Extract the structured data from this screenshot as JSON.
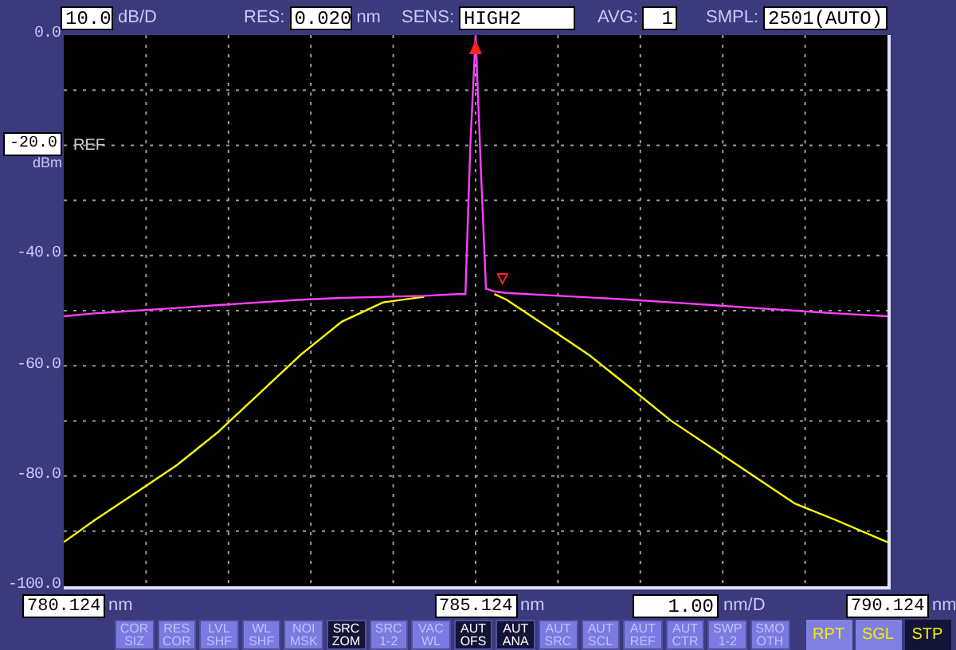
{
  "settings": [
    {
      "value": "10.0",
      "unit": "dB/D"
    },
    {
      "label": "RES:",
      "value": "0.020",
      "unit": "nm"
    },
    {
      "label": "SENS:",
      "value": "HIGH2"
    },
    {
      "label": "AVG:",
      "value": "1"
    },
    {
      "label": "SMPL:",
      "value": "2501(AUTO)"
    }
  ],
  "ref": {
    "value": "-20.0",
    "label": "REF",
    "unit": "dBm"
  },
  "chart_data": {
    "type": "line",
    "xlim": [
      780.124,
      790.124
    ],
    "ylim": [
      -100,
      0
    ],
    "grid": true,
    "xticks": [
      {
        "value": 780.124,
        "label": "780.124"
      },
      {
        "value": 785.124,
        "label": "785.124"
      },
      {
        "value": 790.124,
        "label": "790.124"
      }
    ],
    "yticks": [
      {
        "value": 0,
        "label": "0.0"
      },
      {
        "value": -40,
        "label": "-40.0"
      },
      {
        "value": -60,
        "label": "-60.0"
      },
      {
        "value": -80,
        "label": "-80.0"
      },
      {
        "value": -100,
        "label": "-100.0"
      }
    ],
    "x": [
      780.124,
      780.5,
      781,
      781.5,
      782,
      782.5,
      783,
      783.5,
      784,
      784.5,
      784.9,
      785.0,
      785.06,
      785.124,
      785.19,
      785.25,
      785.35,
      785.5,
      786,
      786.5,
      787,
      787.5,
      788,
      788.5,
      789,
      789.5,
      790.124
    ],
    "series": [
      {
        "color": "#ffff00",
        "values": [
          -92,
          -88,
          -83,
          -78,
          -72,
          -65,
          -58,
          -52,
          -48.5,
          -47.5,
          null,
          null,
          null,
          null,
          null,
          null,
          -47,
          -48,
          -53,
          -58,
          -64,
          -70,
          -75,
          -80,
          -85,
          -88,
          -92
        ]
      },
      {
        "color": "#ff40ff",
        "values": [
          -51,
          -50.5,
          -50,
          -49.5,
          -49,
          -48.5,
          -48,
          -47.7,
          -47.5,
          -47.3,
          -47,
          -47,
          -20,
          0,
          -25,
          -46,
          -46.5,
          -46.8,
          -47.2,
          -47.6,
          -48,
          -48.5,
          -49,
          -49.5,
          -50,
          -50.5,
          -51
        ]
      }
    ]
  },
  "x_units": [
    "nm",
    "nm",
    "nm"
  ],
  "span": {
    "value": "1.00",
    "unit": "nm/D"
  },
  "buttons": [
    {
      "label": "COR SIZ",
      "selected": false
    },
    {
      "label": "RES COR",
      "selected": false
    },
    {
      "label": "LVL SHF",
      "selected": false
    },
    {
      "label": "WL SHF",
      "selected": false
    },
    {
      "label": "NOI MSK",
      "selected": false
    },
    {
      "label": "SRC ZOM",
      "selected": true
    },
    {
      "label": "SRC 1-2",
      "selected": false
    },
    {
      "label": "VAC WL",
      "selected": false
    },
    {
      "label": "AUT OFS",
      "selected": true
    },
    {
      "label": "AUT ANA",
      "selected": true
    },
    {
      "label": "AUT SRC",
      "selected": false
    },
    {
      "label": "AUT SCL",
      "selected": false
    },
    {
      "label": "AUT REF",
      "selected": false
    },
    {
      "label": "AUT CTR",
      "selected": false
    },
    {
      "label": "SWP 1-2",
      "selected": false
    },
    {
      "label": "SMO OTH",
      "selected": false
    }
  ],
  "sweep_buttons": [
    {
      "label": "RPT",
      "selected": false
    },
    {
      "label": "SGL",
      "selected": false
    },
    {
      "label": "STP",
      "selected": true
    }
  ]
}
